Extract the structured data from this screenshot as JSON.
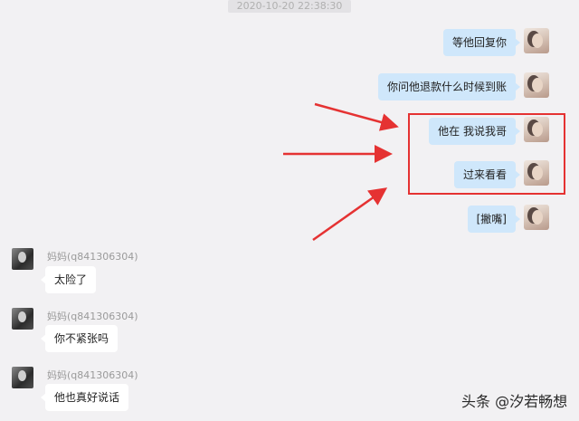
{
  "timestamp": "2020-10-20 22:38:30",
  "outgoing": [
    {
      "text": "等他回复你"
    },
    {
      "text": "你问他退款什么时候到账"
    },
    {
      "text": "他在 我说我哥"
    },
    {
      "text": "过来看看"
    },
    {
      "text": "[撇嘴]"
    }
  ],
  "incoming_sender": "妈妈(q841306304)",
  "incoming": [
    {
      "text": "太险了"
    },
    {
      "text": "你不紧张吗"
    },
    {
      "text": "他也真好说话"
    }
  ],
  "annotation": {
    "highlight_color": "#e53232"
  },
  "watermark": "头条 @汐若畅想"
}
